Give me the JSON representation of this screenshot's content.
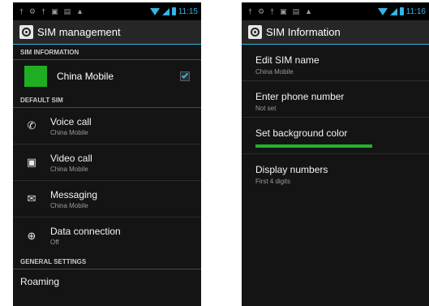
{
  "left": {
    "status": {
      "time": "11:15"
    },
    "app_title": "SIM management",
    "sections": {
      "sim_info": "SIM INFORMATION",
      "default_sim": "DEFAULT SIM",
      "general": "GENERAL SETTINGS"
    },
    "sim": {
      "name": "China Mobile",
      "color": "#1fae22",
      "checked": true
    },
    "default_items": [
      {
        "title": "Voice call",
        "sub": "China Mobile",
        "icon": "phone-icon"
      },
      {
        "title": "Video call",
        "sub": "China Mobile",
        "icon": "video-call-icon"
      },
      {
        "title": "Messaging",
        "sub": "China Mobile",
        "icon": "message-icon"
      },
      {
        "title": "Data connection",
        "sub": "Off",
        "icon": "globe-icon"
      }
    ],
    "roaming": "Roaming"
  },
  "right": {
    "status": {
      "time": "11:16"
    },
    "app_title": "SIM Information",
    "items": [
      {
        "title": "Edit SIM name",
        "sub": "China Mobile"
      },
      {
        "title": "Enter phone number",
        "sub": "Not set"
      },
      {
        "title": "Set background color",
        "color": "#22b42a"
      },
      {
        "title": "Display numbers",
        "sub": "First 4 digits"
      }
    ]
  },
  "colors": {
    "accent": "#33b5e5",
    "background": "#141414",
    "sim_green": "#1fae22"
  }
}
